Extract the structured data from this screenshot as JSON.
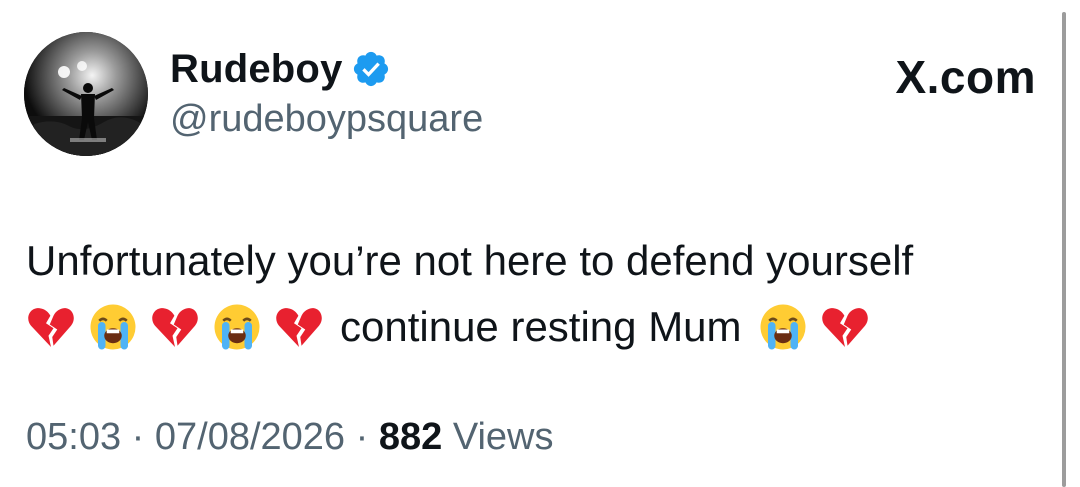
{
  "author": {
    "display_name": "Rudeboy",
    "handle": "@rudeboypsquare",
    "verified": true
  },
  "brand": {
    "label": "X.com"
  },
  "tweet": {
    "line1": "Unfortunately you’re not here to defend yourself",
    "line2_text": "continue resting Mum"
  },
  "meta": {
    "time": "05:03",
    "separator1": "·",
    "date": "07/08/2026",
    "separator2": "·",
    "views_count": "882",
    "views_label": "Views"
  },
  "colors": {
    "text": "#0f1419",
    "secondary": "#536471",
    "verified_blue": "#1d9bf0",
    "broken_heart": "#e8212f",
    "crying_face": "#ffcc33"
  },
  "icons": {
    "verified": "verified-badge-icon",
    "broken_heart": "broken-heart-emoji",
    "crying": "loudly-crying-face-emoji"
  }
}
